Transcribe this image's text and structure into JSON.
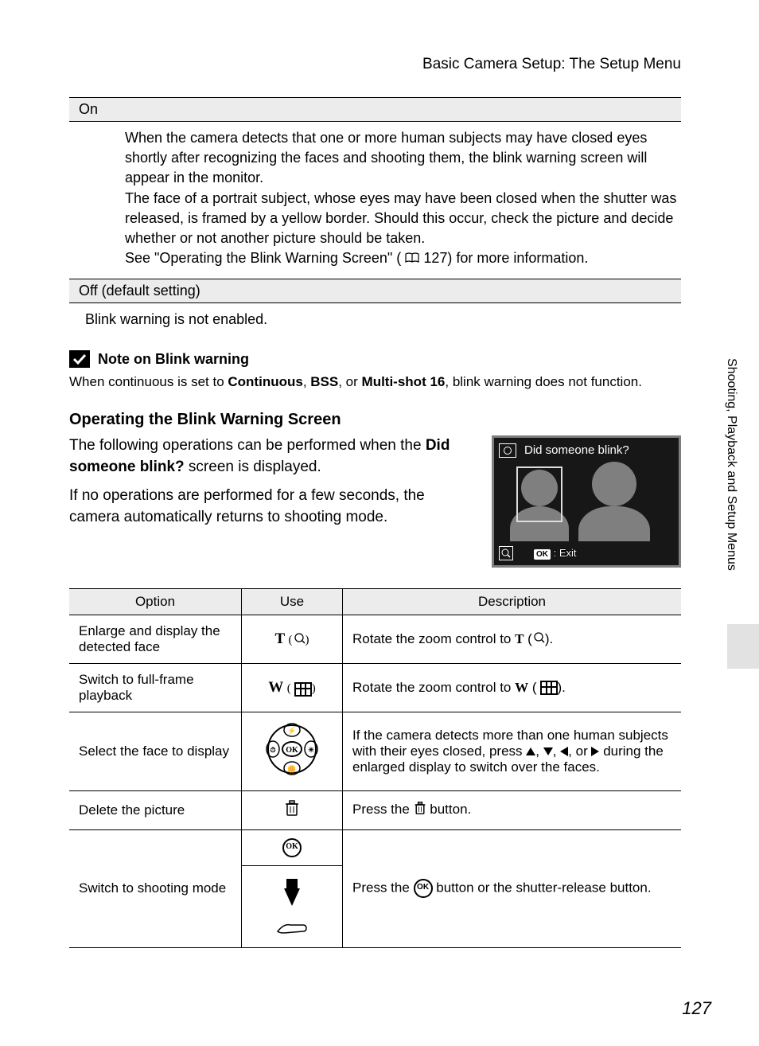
{
  "header": {
    "title": "Basic Camera Setup: The Setup Menu"
  },
  "settings": {
    "on": {
      "label": "On",
      "body_l1": "When the camera detects that one or more human subjects may have closed eyes shortly after recognizing the faces and shooting them, the blink warning screen will appear in the monitor.",
      "body_l2": "The face of a portrait subject, whose eyes may have been closed when the shutter was released, is framed by a yellow border. Should this occur, check the picture and decide whether or not another picture should be taken.",
      "body_l3_pre": "See \"Operating the Blink Warning Screen\" (",
      "body_l3_ref": "127",
      "body_l3_post": ") for more information."
    },
    "off": {
      "label": "Off (default setting)",
      "body": "Blink warning is not enabled."
    }
  },
  "note": {
    "title": "Note on Blink warning",
    "text_pre": "When continuous is set to ",
    "b1": "Continuous",
    "sep1": ", ",
    "b2": "BSS",
    "sep2": ", or ",
    "b3": "Multi-shot 16",
    "text_post": ", blink warning does not function."
  },
  "operating": {
    "heading": "Operating the Blink Warning Screen",
    "p1_pre": "The following operations can be performed when the ",
    "p1_bold": "Did someone blink?",
    "p1_post": " screen is displayed.",
    "p2": "If no operations are performed for a few seconds, the camera automatically returns to shooting mode."
  },
  "camera_screen": {
    "title": "Did someone blink?",
    "exit_label": ": Exit",
    "ok": "OK"
  },
  "table": {
    "headers": {
      "option": "Option",
      "use": "Use",
      "description": "Description"
    },
    "rows": [
      {
        "option": "Enlarge and display the detected face",
        "use_main": "T",
        "use_icon": "zoom-in",
        "desc_pre": "Rotate the zoom control to ",
        "desc_sym": "T",
        "desc_post": "."
      },
      {
        "option": "Switch to full-frame playback",
        "use_main": "W",
        "use_icon": "thumb-grid",
        "desc_pre": "Rotate the zoom control to ",
        "desc_sym": "W",
        "desc_post": "."
      },
      {
        "option": "Select the face to display",
        "use_icon": "multi-selector",
        "desc_pre": "If the camera detects more than one human subjects with their eyes closed, press ",
        "desc_post": " during the enlarged display to switch over the faces."
      },
      {
        "option": "Delete the picture",
        "use_icon": "trash",
        "desc_pre": "Press the ",
        "desc_post": " button."
      },
      {
        "option": "Switch to shooting mode",
        "use_icon": "ok-shutter",
        "desc_pre": "Press the ",
        "desc_post": " button or the shutter-release button."
      }
    ]
  },
  "side_label": "Shooting, Playback and Setup Menus",
  "page_number": "127"
}
